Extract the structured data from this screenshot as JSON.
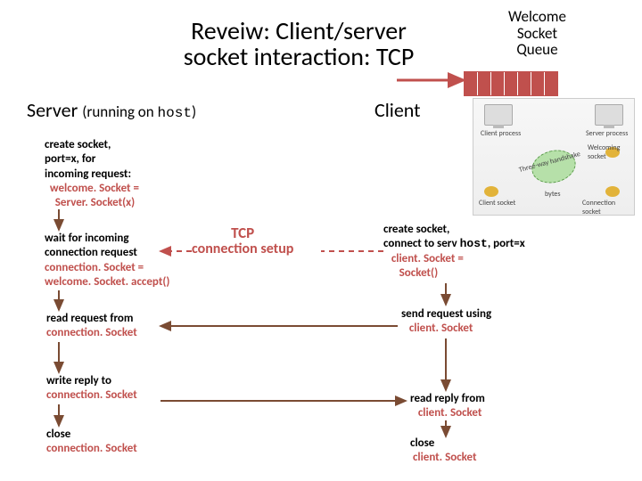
{
  "title_line1": "Reveiw: Client/server",
  "title_line2": "socket interaction: TCP",
  "queue_label_l1": "Welcome",
  "queue_label_l2": "Socket",
  "queue_label_l3": "Queue",
  "server_header_a": "Server ",
  "server_header_b": "(running on ",
  "server_header_c": "host",
  "server_header_d": ")",
  "client_header": "Client",
  "create_srv_l1": "create socket,",
  "create_srv_l2": "port=x, for",
  "create_srv_l3": "incoming request:",
  "create_srv_l4": "welcome. Socket =",
  "create_srv_l5": "Server. Socket(x)",
  "wait_l1": "wait for incoming",
  "wait_l2": "connection request",
  "wait_l3": "connection. Socket =",
  "wait_l4": "welcome. Socket. accept()",
  "readreq_l1": "read request from",
  "readreq_l2": "connection. Socket",
  "writereply_l1": "write reply to",
  "writereply_l2": "connection. Socket",
  "close_srv_l1": "close",
  "close_srv_l2": "connection. Socket",
  "tcp_l1": "TCP",
  "tcp_l2": "connection setup",
  "create_cli_l1": "create socket,",
  "create_cli_l2a": "connect to serv ",
  "create_cli_l2b": "host",
  "create_cli_l2c": ", port=x",
  "create_cli_l3": "client. Socket =",
  "create_cli_l4": "Socket()",
  "sendreq_l1": "send request using",
  "sendreq_l2": "client. Socket",
  "readreply_l1": "read reply from",
  "readreply_l2": "client. Socket",
  "close_cli_l1": "close",
  "close_cli_l2": "client. Socket",
  "img_client_proc": "Client process",
  "img_server_proc": "Server process",
  "img_welcoming": "Welcoming socket",
  "img_conn": "Connection socket",
  "img_client_sock": "Client socket",
  "img_handshake": "Three-way handshake",
  "img_bytes": "bytes",
  "colors": {
    "maroon": "#c0504d",
    "slide_edge": "#7a4b33"
  }
}
